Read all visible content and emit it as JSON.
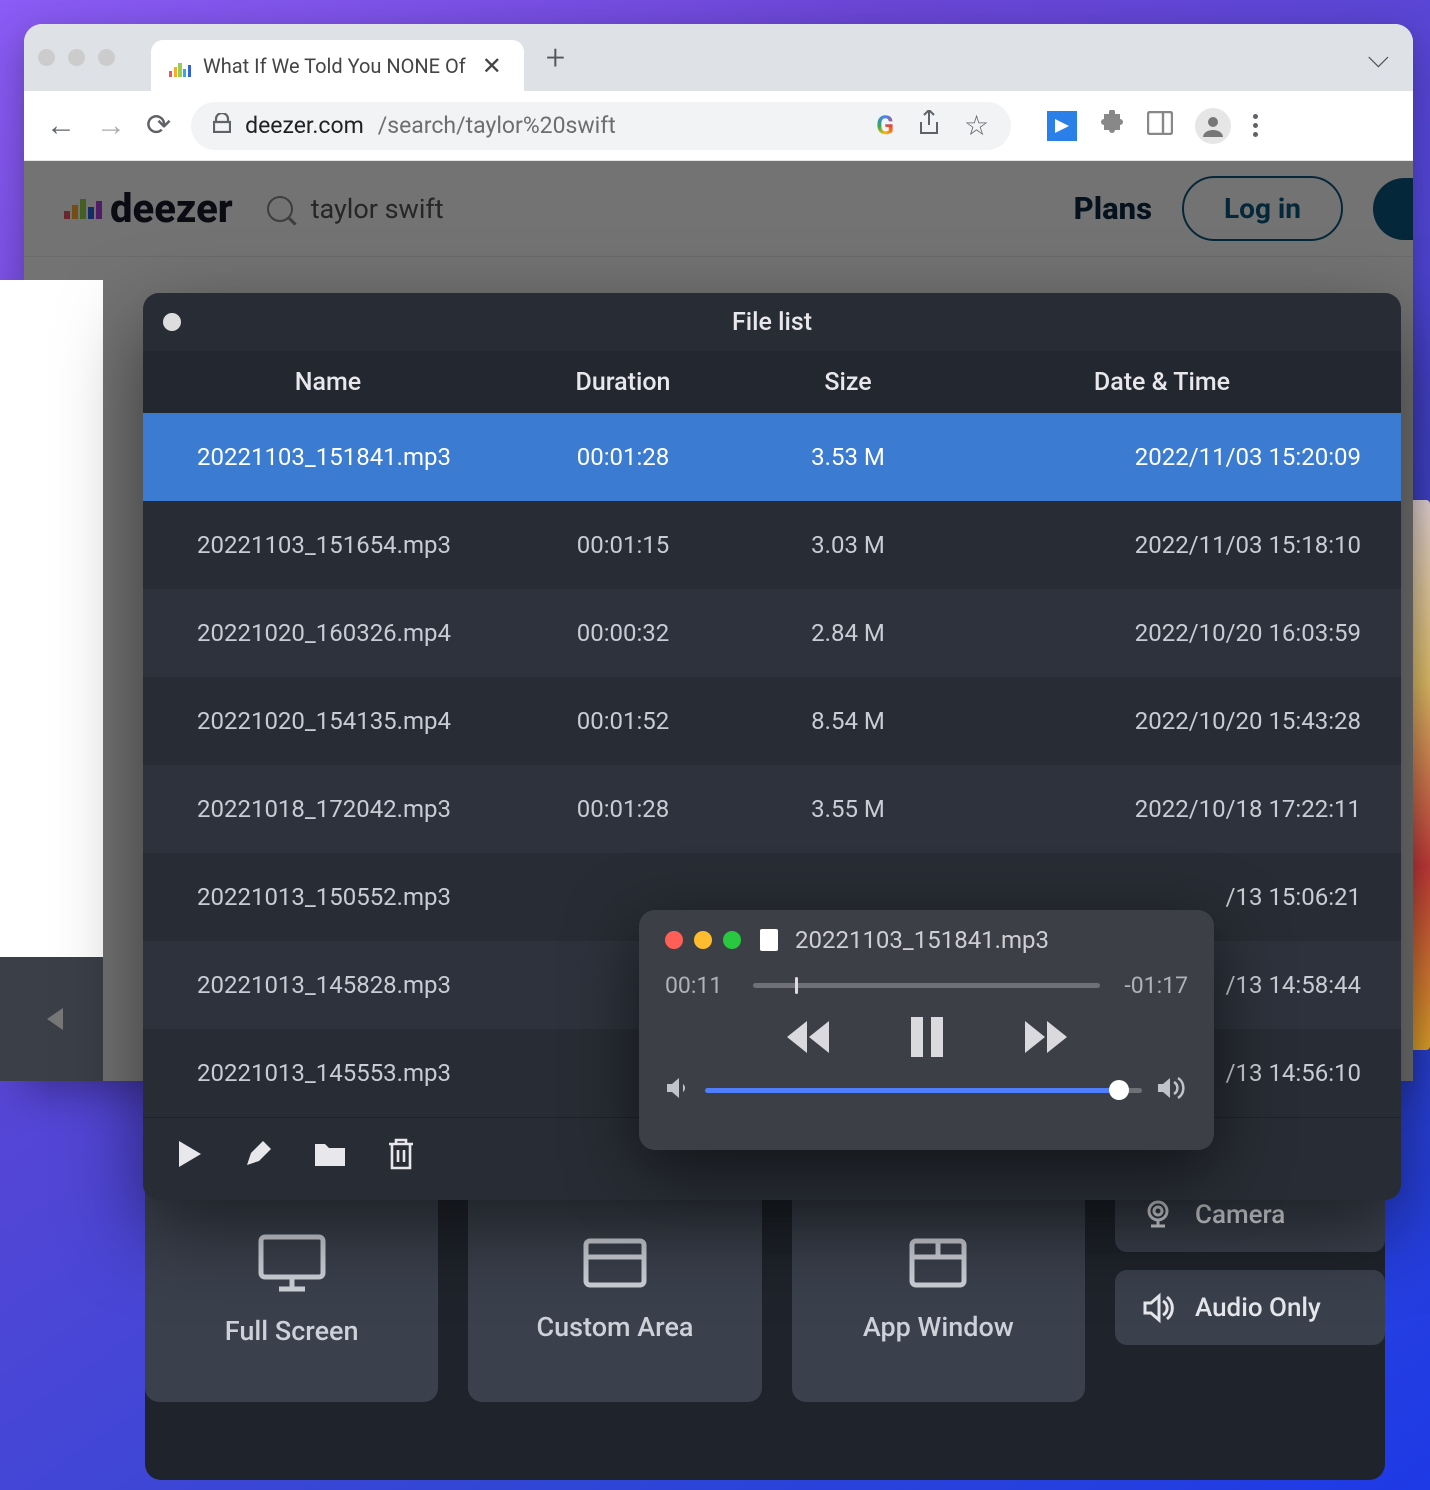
{
  "browser": {
    "tab_title": "What If We Told You NONE Of",
    "url_domain": "deezer.com",
    "url_path": "/search/taylor%20swift"
  },
  "deezer": {
    "logo_text": "deezer",
    "search_query": "taylor swift",
    "plans_label": "Plans",
    "login_label": "Log in"
  },
  "file_list": {
    "title": "File list",
    "columns": {
      "name": "Name",
      "duration": "Duration",
      "size": "Size",
      "datetime": "Date & Time"
    },
    "rows": [
      {
        "name": "20221103_151841.mp3",
        "duration": "00:01:28",
        "size": "3.53 M",
        "datetime": "2022/11/03 15:20:09",
        "selected": true
      },
      {
        "name": "20221103_151654.mp3",
        "duration": "00:01:15",
        "size": "3.03 M",
        "datetime": "2022/11/03 15:18:10",
        "selected": false
      },
      {
        "name": "20221020_160326.mp4",
        "duration": "00:00:32",
        "size": "2.84 M",
        "datetime": "2022/10/20 16:03:59",
        "selected": false
      },
      {
        "name": "20221020_154135.mp4",
        "duration": "00:01:52",
        "size": "8.54 M",
        "datetime": "2022/10/20 15:43:28",
        "selected": false
      },
      {
        "name": "20221018_172042.mp3",
        "duration": "00:01:28",
        "size": "3.55 M",
        "datetime": "2022/10/18 17:22:11",
        "selected": false
      },
      {
        "name": "20221013_150552.mp3",
        "duration": "",
        "size": "",
        "datetime": "/13 15:06:21",
        "selected": false
      },
      {
        "name": "20221013_145828.mp3",
        "duration": "",
        "size": "",
        "datetime": "/13 14:58:44",
        "selected": false
      },
      {
        "name": "20221013_145553.mp3",
        "duration": "",
        "size": "",
        "datetime": "/13 14:56:10",
        "selected": false
      }
    ]
  },
  "player": {
    "file_name": "20221103_151841.mp3",
    "elapsed": "00:11",
    "remaining": "-01:17"
  },
  "recorder": {
    "modes": {
      "full_screen": "Full Screen",
      "custom_area": "Custom Area",
      "app_window": "App Window"
    },
    "side": {
      "camera": "Camera",
      "audio_only": "Audio Only"
    }
  }
}
